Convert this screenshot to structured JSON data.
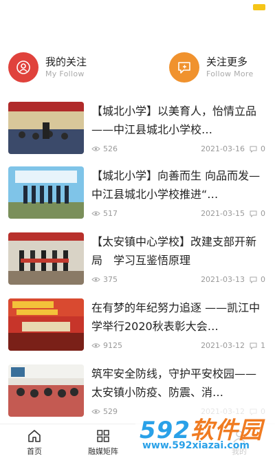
{
  "follow": {
    "my": {
      "title": "我的关注",
      "subtitle": "My Follow"
    },
    "more": {
      "title": "关注更多",
      "subtitle": "Follow  More"
    }
  },
  "news": [
    {
      "title": "【城北小学】以美育人，怡情立品 ——中江县城北小学校…",
      "views": "526",
      "date": "2021-03-16",
      "comments": "0"
    },
    {
      "title": "【城北小学】向善而生 向品而发—中江县城北小学校推进“…",
      "views": "517",
      "date": "2021-03-15",
      "comments": "0"
    },
    {
      "title": "【太安镇中心学校】改建支部开新局　学习互鉴悟原理",
      "views": "375",
      "date": "2021-03-13",
      "comments": "0"
    },
    {
      "title": "在有梦的年纪努力追逐 ——凯江中学举行2020秋表彰大会…",
      "views": "9125",
      "date": "2021-03-12",
      "comments": "1"
    },
    {
      "title": "筑牢安全防线，守护平安校园——太安镇小防疫、防震、消…",
      "views": "529",
      "date": "2021-03-12",
      "comments": "0"
    }
  ],
  "tabbar": {
    "home": "首页",
    "media": "融媒矩阵",
    "mine": "我的"
  },
  "watermark": {
    "brand_num": "592",
    "brand_cn": "软件园",
    "url": "www.592xiazai.com"
  },
  "colors": {
    "accent_red": "#e0423c",
    "accent_orange": "#f0922e",
    "notif": "#f5c518"
  }
}
